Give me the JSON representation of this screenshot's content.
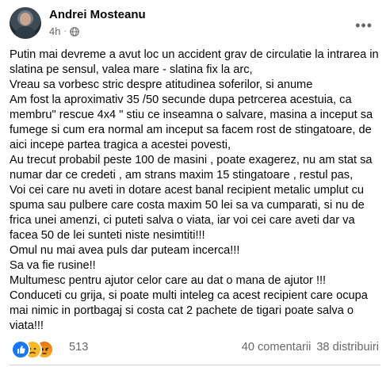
{
  "post": {
    "author": "Andrei Mosteanu",
    "time": "4h",
    "separator": "·",
    "privacy_icon": "globe-icon",
    "more_icon": "more-options-icon",
    "more_glyph": "•••",
    "paragraphs": [
      "Putin mai devreme a avut loc un accident grav de circulatie la intrarea in slatina pe sensul, valea mare - slatina fix la arc,",
      "Vreau sa vorbesc stric despre atitudinea soferilor, si anume",
      "Am fost la  aproximativ 35 /50  secunde dupa petrcerea acestuia, ca membru\" rescue 4x4 \" stiu ce inseamna o salvare, masina a inceput sa fumege si cum era normal am inceput sa facem rost de stingatoare, de aici incepe partea tragica a acestei povesti,",
      "Au trecut probabil peste 100 de masini , poate exagerez, nu am stat sa numar dar ce credeti , am strans maxim 15 stingatoare , restul pas,",
      "Voi cei care nu aveti in dotare acest banal recipient metalic umplut cu spuma sau pulbere  care costa maxim 50 lei sa va cumparati, si nu de frica unei amenzi, ci puteti salva o viata, iar voi cei care aveti dar va facea 50 de lei sunteti niste nesimtiti!!!",
      "Omul nu mai avea puls dar puteam incerca!!!",
      "Sa va fie rusine!!",
      "Multumesc pentru ajutor celor care au dat o mana de ajutor !!!",
      "Conduceti cu grija, si poate multi inteleg ca acest recipient care ocupa mai nimic in portbagaj si costa cat 2 pachete de tigari poate salva o viata!!!"
    ]
  },
  "footer": {
    "reaction_icons": [
      "like-icon",
      "sad-icon",
      "angry-icon"
    ],
    "reaction_count": "513",
    "comments": "40 comentarii",
    "shares": "38 distribuiri"
  },
  "colors": {
    "like": "#1877f2",
    "sad": "#f7b928",
    "angry": "#e9710f",
    "secondary_text": "#65676b"
  }
}
